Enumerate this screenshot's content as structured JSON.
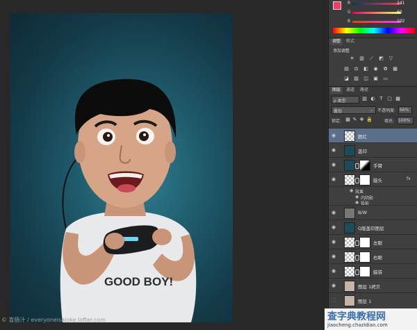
{
  "color_panel": {
    "r_label": "R",
    "g_label": "G",
    "b_label": "B",
    "r_value": "241",
    "g_value": "60",
    "b_value": "102",
    "swatch": "#f13c66"
  },
  "adjustments": {
    "tab_1": "调整",
    "tab_2": "样式",
    "heading": "添加调整"
  },
  "layers_panel": {
    "tab_layers": "图层",
    "tab_channels": "通道",
    "tab_paths": "路径",
    "filter_label": "ρ 类型",
    "blend_mode": "叠加",
    "opacity_label": "不透明度:",
    "opacity_value": "66%",
    "lock_label": "锁定:",
    "fill_label": "填充:",
    "fill_value": "100%",
    "fx_label": "fx",
    "effects_label": "效果",
    "inner_shadow": "内阴影",
    "drop_shadow": "投影"
  },
  "layers": [
    {
      "name": "腮红"
    },
    {
      "name": "盖印"
    },
    {
      "name": "手臂"
    },
    {
      "name": "脑头"
    },
    {
      "name": "B/W"
    },
    {
      "name": "Q版盖印图层"
    },
    {
      "name": "左眼"
    },
    {
      "name": "右眼"
    },
    {
      "name": "脑袋"
    },
    {
      "name": "图层 1拷贝"
    },
    {
      "name": "图层 1"
    }
  ],
  "footer": {
    "credit": "© 盲肠汁 / everyoneisajoke.lofter.com",
    "watermark": "查字典教程网",
    "watermark_url": "jiaocheng.chazidian.com"
  },
  "photo": {
    "shirt_text": "GOOD BOY!"
  }
}
